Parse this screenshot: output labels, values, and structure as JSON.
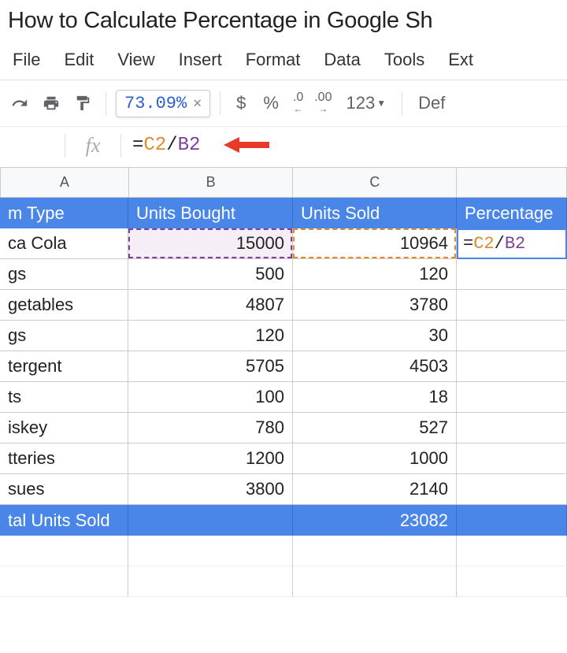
{
  "title": "How to Calculate Percentage in Google Sh",
  "menu": {
    "file": "File",
    "edit": "Edit",
    "view": "View",
    "insert": "Insert",
    "format": "Format",
    "data": "Data",
    "tools": "Tools",
    "ext": "Ext"
  },
  "toolbar": {
    "hint_value": "73.09%",
    "currency": "$",
    "percent": "%",
    "dec_less": ".0",
    "dec_more": ".00",
    "numfmt": "123",
    "font": "Def"
  },
  "formula_bar": {
    "fx": "fx",
    "eq": "=",
    "c_ref": "C2",
    "slash": "/",
    "b_ref": "B2"
  },
  "columns": {
    "a": "A",
    "b": "B",
    "c": "C",
    "d": ""
  },
  "headers": {
    "a": "m Type",
    "b": "Units Bought",
    "c": "Units Sold",
    "d": "Percentage"
  },
  "rows": [
    {
      "a": "ca Cola",
      "b": "15000",
      "c": "10964"
    },
    {
      "a": "gs",
      "b": "500",
      "c": "120"
    },
    {
      "a": "getables",
      "b": "4807",
      "c": "3780"
    },
    {
      "a": "gs",
      "b": "120",
      "c": "30"
    },
    {
      "a": "tergent",
      "b": "5705",
      "c": "4503"
    },
    {
      "a": "ts",
      "b": "100",
      "c": "18"
    },
    {
      "a": "iskey",
      "b": "780",
      "c": "527"
    },
    {
      "a": "tteries",
      "b": "1200",
      "c": "1000"
    },
    {
      "a": "sues",
      "b": "3800",
      "c": "2140"
    }
  ],
  "total_row": {
    "a": "tal Units Sold",
    "b": "",
    "c": "23082"
  },
  "editing_cell": {
    "eq": "=",
    "c_ref": "C2",
    "slash": "/",
    "b_ref": "B2"
  },
  "chart_data": {
    "type": "table",
    "title": "How to Calculate Percentage in Google Sheets",
    "columns": [
      "Item Type",
      "Units Bought",
      "Units Sold",
      "Percentage"
    ],
    "rows": [
      [
        "...ca Cola",
        15000,
        10964,
        "=C2/B2"
      ],
      [
        "...gs",
        500,
        120,
        null
      ],
      [
        "...getables",
        4807,
        3780,
        null
      ],
      [
        "...gs",
        120,
        30,
        null
      ],
      [
        "...tergent",
        5705,
        4503,
        null
      ],
      [
        "...ts",
        100,
        18,
        null
      ],
      [
        "...iskey",
        780,
        527,
        null
      ],
      [
        "...tteries",
        1200,
        1000,
        null
      ],
      [
        "...sues",
        3800,
        2140,
        null
      ],
      [
        "...tal Units Sold",
        null,
        23082,
        null
      ]
    ],
    "formula_result_preview": "73.09%"
  }
}
